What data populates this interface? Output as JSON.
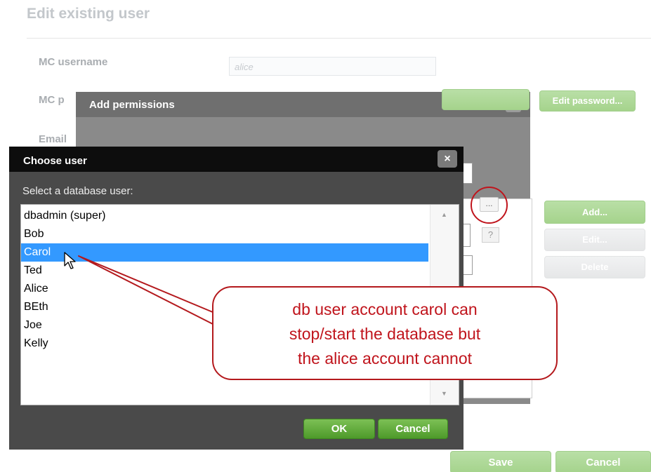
{
  "page": {
    "title": "Edit existing user",
    "labels": {
      "username": "MC username",
      "password": "MC p",
      "email": "Email"
    },
    "username_value": "alice",
    "buttons": {
      "edit_password": "Edit password...",
      "add": "Add...",
      "edit": "Edit...",
      "delete": "Delete",
      "save": "Save",
      "cancel": "Cancel"
    }
  },
  "add_permissions_dialog": {
    "title": "Add permissions",
    "close_glyph": "×",
    "browse_label": "...",
    "help_label": "?"
  },
  "choose_user_dialog": {
    "title": "Choose user",
    "close_glyph": "×",
    "prompt": "Select a database user:",
    "users": [
      "dbadmin (super)",
      "Bob",
      "Carol",
      "Ted",
      "Alice",
      "BEth",
      "Joe",
      "Kelly"
    ],
    "selected_user": "Carol",
    "buttons": {
      "ok": "OK",
      "cancel": "Cancel"
    },
    "scroll_up_glyph": "▲",
    "scroll_down_glyph": "▼"
  },
  "callout": {
    "lines": [
      "db user account carol can",
      "stop/start the database but",
      "the alice account cannot"
    ]
  },
  "colors": {
    "selection": "#3399ff",
    "dialog_header": "#0d0d0d",
    "ok_button": "#5aa834",
    "annotation_red": "#c0141c"
  }
}
